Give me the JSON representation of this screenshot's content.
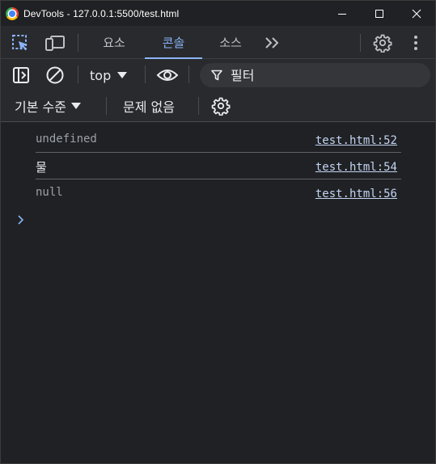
{
  "window": {
    "title": "DevTools - 127.0.0.1:5500/test.html"
  },
  "tabs": [
    {
      "label": "요소"
    },
    {
      "label": "콘솔"
    },
    {
      "label": "소스"
    }
  ],
  "console_toolbar": {
    "context": "top",
    "filter_placeholder": "필터"
  },
  "levels_toolbar": {
    "levels_label": "기본 수준",
    "issues_label": "문제 없음"
  },
  "messages": [
    {
      "text": "undefined",
      "source": "test.html:52"
    },
    {
      "text": "물",
      "source": "test.html:54"
    },
    {
      "text": "null",
      "source": "test.html:56"
    }
  ],
  "colors": {
    "accent": "#8ab4f8",
    "background": "#202124",
    "toolbar": "#292a2d"
  }
}
